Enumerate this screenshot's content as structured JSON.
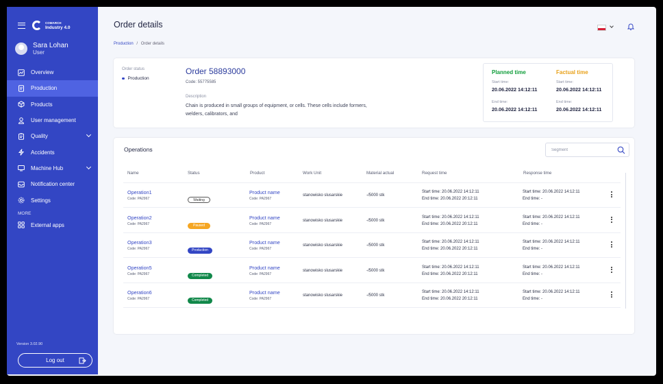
{
  "app": {
    "logo_line1": "COMARCH",
    "logo_line2": "Industry 4.0"
  },
  "user": {
    "name": "Sara Lohan",
    "role": "User"
  },
  "nav": [
    {
      "label": "Overview",
      "icon": "chart-icon",
      "active": false
    },
    {
      "label": "Production",
      "icon": "document-icon",
      "active": true
    },
    {
      "label": "Products",
      "icon": "box-icon",
      "active": false
    },
    {
      "label": "User management",
      "icon": "user-icon",
      "active": false
    },
    {
      "label": "Quality",
      "icon": "clipboard-icon",
      "active": false,
      "chevron": true
    },
    {
      "label": "Accidents",
      "icon": "bolt-icon",
      "active": false
    },
    {
      "label": "Machine Hub",
      "icon": "monitor-icon",
      "active": false,
      "chevron": true
    },
    {
      "label": "Notification center",
      "icon": "inbox-icon",
      "active": false
    },
    {
      "label": "Settings",
      "icon": "gear-icon",
      "active": false
    }
  ],
  "nav_more_label": "MORE",
  "nav_more": [
    {
      "label": "External apps",
      "icon": "grid-icon"
    }
  ],
  "version": "Version 3.02.90",
  "logout_label": "Log out",
  "header": {
    "title": "Order details",
    "breadcrumb_link": "Production",
    "breadcrumb_sep": "/",
    "breadcrumb_current": "Order details"
  },
  "order": {
    "status_label": "Order status",
    "status": "Production",
    "number": "Order 58893000",
    "code": "Code: 55775585",
    "description_label": "Description",
    "description": "Chain is produced in small groups of equipment, or cells. These cells include formers, welders, calibrators, and"
  },
  "planned": {
    "title": "Planned time",
    "start_label": "Start time:",
    "start": "20.06.2022 14:12:11",
    "end_label": "End time:",
    "end": "20.06.2022 14:12:11"
  },
  "factual": {
    "title": "Factual time",
    "start_label": "Start time:",
    "start": "20.06.2022 14:12:11",
    "end_label": "End time:",
    "end": "20.06.2022 14:12:11"
  },
  "operations": {
    "title": "Operations",
    "search_placeholder": "Segment",
    "columns": [
      "Name",
      "Status",
      "Product",
      "Work Unit",
      "Material actual",
      "Request time",
      "Response time"
    ],
    "rows": [
      {
        "name": "Operation1",
        "code": "Code: PA2967",
        "status": "Waiting",
        "status_kind": "waiting",
        "product": "Product name",
        "product_code": "Code: PA2967",
        "work_unit": "stanowisko slusarskie",
        "material": "-/5000 stk",
        "req_start": "Start time: 20.06.2022 14:12:11",
        "req_end": "End time: 20.06.2022 20:12:11",
        "res_start": "Start time: 20.06.2022 14:12:11",
        "res_end": "End time: -"
      },
      {
        "name": "Operation2",
        "code": "Code: PA2967",
        "status": "Paused",
        "status_kind": "paused",
        "product": "Product name",
        "product_code": "Code: PA2967",
        "work_unit": "stanowisko slusarskie",
        "material": "-/5000 stk",
        "req_start": "Start time: 20.06.2022 14:12:11",
        "req_end": "End time: 20.06.2022 20:12:11",
        "res_start": "Start time: 20.06.2022 14:12:11",
        "res_end": "End time: -"
      },
      {
        "name": "Operation3",
        "code": "Code: PA2967",
        "status": "Production",
        "status_kind": "production",
        "product": "Product name",
        "product_code": "Code: PA2967",
        "work_unit": "stanowisko slusarskie",
        "material": "-/5000 stk",
        "req_start": "Start time: 20.06.2022 14:12:11",
        "req_end": "End time: 20.06.2022 20:12:11",
        "res_start": "Start time: 20.06.2022 14:12:11",
        "res_end": "End time: -"
      },
      {
        "name": "Operation5",
        "code": "Code: PA2967",
        "status": "Completed",
        "status_kind": "completed",
        "product": "Product name",
        "product_code": "Code: PA2967",
        "work_unit": "stanowisko slusarskie",
        "material": "-/5000 stk",
        "req_start": "Start time: 20.06.2022 14:12:11",
        "req_end": "End time: 20.06.2022 20:12:11",
        "res_start": "Start time: 20.06.2022 14:12:11",
        "res_end": "End time: -"
      },
      {
        "name": "Operation6",
        "code": "Code: PA2967",
        "status": "Completed",
        "status_kind": "completed",
        "product": "Product name",
        "product_code": "Code: PA2967",
        "work_unit": "stanowisko slusarskie",
        "material": "-/5000 stk",
        "req_start": "Start time: 20.06.2022 14:12:11",
        "req_end": "End time: 20.06.2022 20:12:11",
        "res_start": "Start time: 20.06.2022 14:12:11",
        "res_end": "End time: -"
      }
    ]
  },
  "colors": {
    "sidebar": "#3346c4",
    "active": "#4f63e2",
    "planned": "#0f9d3a",
    "factual": "#e8a11a",
    "paused": "#f5a623",
    "completed": "#11884a"
  }
}
